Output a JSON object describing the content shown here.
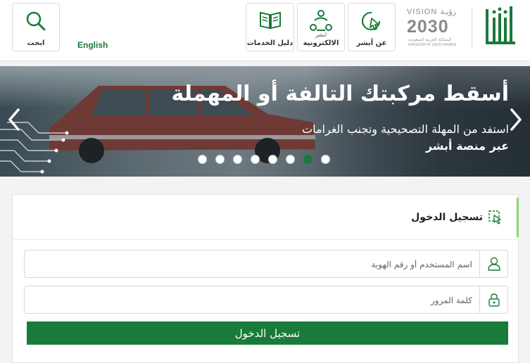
{
  "header": {
    "search_label": "ابحث",
    "language_link": "English",
    "services_guide_label": "دليل الخدمات",
    "eservices_label": "الالكترونية",
    "eservices_top": "ابشر",
    "about_label": "عن أبشر",
    "vision": {
      "top": "VISION رؤيـة",
      "year": "2030",
      "arabic": "المملكة العربية السعودية",
      "english": "KINGDOM OF SAUDI ARABIA"
    },
    "logo_text": "أبشر"
  },
  "banner": {
    "title": "أسقط مركبتك التالفة أو المهملة",
    "subtitle": "استفد من المهلة التصحيحية وتجنب الغرامات",
    "subtitle2": "عبر منصة أبشر",
    "slides_count": 8,
    "active_slide": 6
  },
  "login": {
    "title": "تسجيل الدخول",
    "username_placeholder": "اسم المستخدم أو رقم الهوية",
    "password_placeholder": "كلمة المرور",
    "submit_label": "تسجيل الدخول"
  },
  "colors": {
    "brand_green": "#1a7a3a",
    "accent_green": "#88d46f"
  }
}
